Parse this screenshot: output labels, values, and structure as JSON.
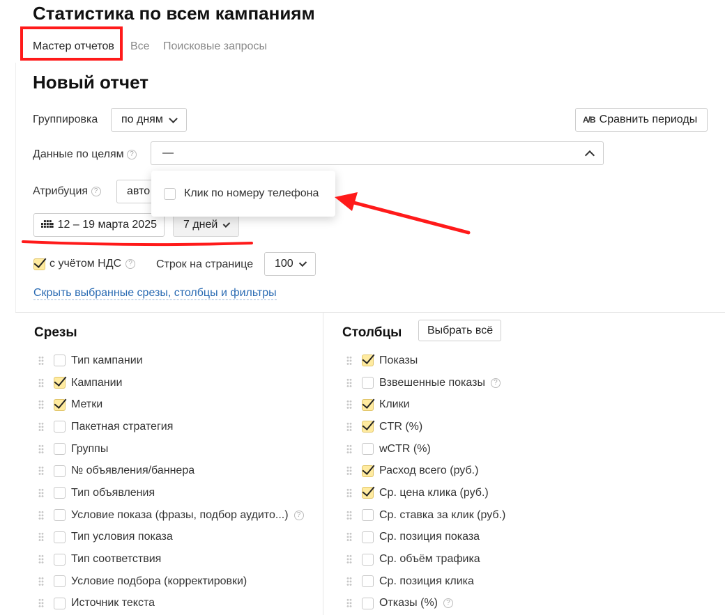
{
  "page": {
    "title": "Статистика по всем кампаниям"
  },
  "tabs": [
    {
      "label": "Мастер отчетов",
      "active": true
    },
    {
      "label": "Все",
      "active": false
    },
    {
      "label": "Поисковые запросы",
      "active": false
    }
  ],
  "report": {
    "title": "Новый отчет",
    "grouping": {
      "label": "Группировка",
      "value": "по дням"
    },
    "compare_button": "Сравнить периоды",
    "compare_icon_text": "A/B",
    "goals": {
      "label": "Данные по целям",
      "value": "—"
    },
    "goals_dropdown": {
      "option": "Клик по номеру телефона",
      "checked": false
    },
    "attribution": {
      "label": "Атрибуция",
      "value": "авто"
    },
    "date_range": "12 – 19 марта 2025",
    "period": "7 дней",
    "vat": {
      "label": "с учётом НДС",
      "checked": true
    },
    "rows_per_page": {
      "label": "Строк на странице",
      "value": "100"
    },
    "hide_link": "Скрыть выбранные срезы, столбцы и фильтры"
  },
  "slices": {
    "title": "Срезы",
    "items": [
      {
        "label": "Тип кампании",
        "checked": false,
        "help": false
      },
      {
        "label": "Кампании",
        "checked": true,
        "help": false
      },
      {
        "label": "Метки",
        "checked": true,
        "help": false
      },
      {
        "label": "Пакетная стратегия",
        "checked": false,
        "help": false
      },
      {
        "label": "Группы",
        "checked": false,
        "help": false
      },
      {
        "label": "№ объявления/баннера",
        "checked": false,
        "help": false
      },
      {
        "label": "Тип объявления",
        "checked": false,
        "help": false
      },
      {
        "label": "Условие показа (фразы, подбор аудито...)",
        "checked": false,
        "help": true
      },
      {
        "label": "Тип условия показа",
        "checked": false,
        "help": false
      },
      {
        "label": "Тип соответствия",
        "checked": false,
        "help": false
      },
      {
        "label": "Условие подбора (корректировки)",
        "checked": false,
        "help": false
      },
      {
        "label": "Источник текста",
        "checked": false,
        "help": false
      }
    ]
  },
  "columns": {
    "title": "Столбцы",
    "select_all": "Выбрать всё",
    "items": [
      {
        "label": "Показы",
        "checked": true,
        "help": false
      },
      {
        "label": "Взвешенные показы",
        "checked": false,
        "help": true
      },
      {
        "label": "Клики",
        "checked": true,
        "help": false
      },
      {
        "label": "CTR (%)",
        "checked": true,
        "help": false
      },
      {
        "label": "wCTR (%)",
        "checked": false,
        "help": false
      },
      {
        "label": "Расход всего (руб.)",
        "checked": true,
        "help": false
      },
      {
        "label": "Ср. цена клика (руб.)",
        "checked": true,
        "help": false
      },
      {
        "label": "Ср. ставка за клик (руб.)",
        "checked": false,
        "help": false
      },
      {
        "label": "Ср. позиция показа",
        "checked": false,
        "help": false
      },
      {
        "label": "Ср. объём трафика",
        "checked": false,
        "help": false
      },
      {
        "label": "Ср. позиция клика",
        "checked": false,
        "help": false
      },
      {
        "label": "Отказы (%)",
        "checked": false,
        "help": true
      }
    ]
  },
  "colors": {
    "annotation": "#ff1a1a",
    "link": "#2a6bb3",
    "checked_bg": "#ffeba0"
  }
}
